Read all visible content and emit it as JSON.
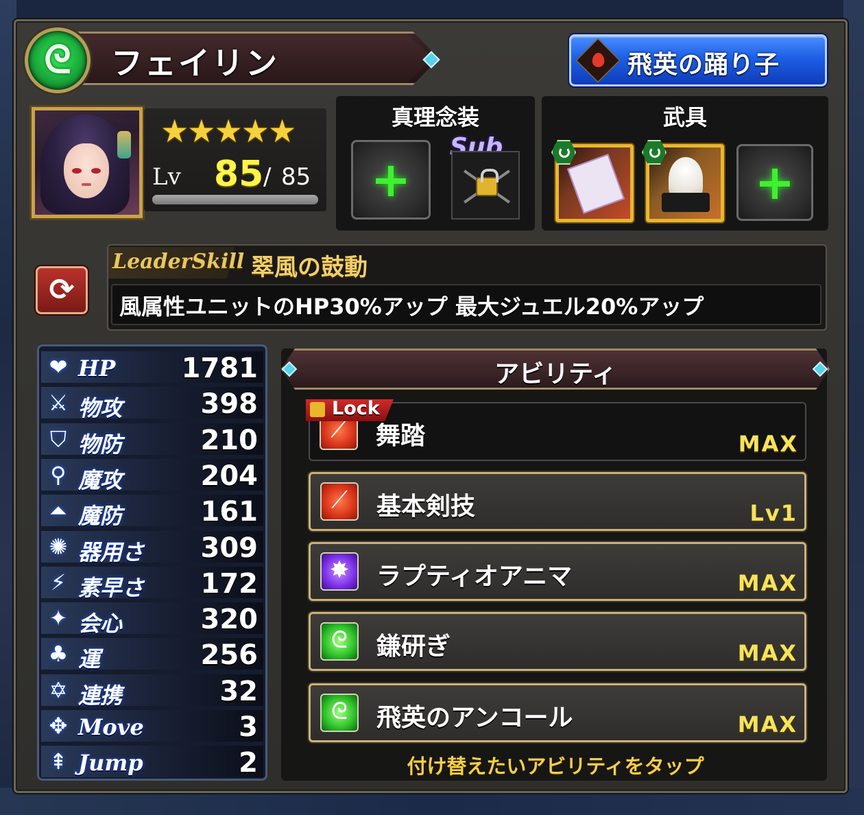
{
  "character": {
    "name": "フェイリン",
    "element_icon": "wind-element-icon",
    "title": "飛英の踊り子",
    "stars": "★★★★★",
    "level_label": "Lv",
    "level": "85",
    "level_separator": "/",
    "level_max": "85",
    "level_progress": 1.0
  },
  "truth_panel": {
    "title": "真理念装",
    "sub_label": "Sub"
  },
  "gear_panel": {
    "title": "武具"
  },
  "leader_skill": {
    "tag": "LeaderSkill",
    "name": "翠風の鼓動",
    "description": "風属性ユニットのHP30%アップ  最大ジュエル20%アップ"
  },
  "stats": [
    {
      "label": "HP",
      "value": "1781",
      "icon": "heart-icon",
      "glyph": "❤"
    },
    {
      "label": "物攻",
      "value": "398",
      "icon": "sword-icon",
      "glyph": "⚔"
    },
    {
      "label": "物防",
      "value": "210",
      "icon": "shield-icon",
      "glyph": "⛉"
    },
    {
      "label": "魔攻",
      "value": "204",
      "icon": "staff-icon",
      "glyph": "⚲"
    },
    {
      "label": "魔防",
      "value": "161",
      "icon": "magic-shield-icon",
      "glyph": "⏶"
    },
    {
      "label": "器用さ",
      "value": "309",
      "icon": "dexterity-icon",
      "glyph": "✺"
    },
    {
      "label": "素早さ",
      "value": "172",
      "icon": "boot-icon",
      "glyph": "⚡"
    },
    {
      "label": "会心",
      "value": "320",
      "icon": "critical-icon",
      "glyph": "✦"
    },
    {
      "label": "運",
      "value": "256",
      "icon": "clover-icon",
      "glyph": "♣"
    },
    {
      "label": "連携",
      "value": "32",
      "icon": "link-icon",
      "glyph": "✡"
    },
    {
      "label": "Move",
      "value": "3",
      "icon": "move-arrows-icon",
      "glyph": "✥"
    },
    {
      "label": "Jump",
      "value": "2",
      "icon": "jump-icon",
      "glyph": "⇞"
    }
  ],
  "abilities": {
    "header": "アビリティ",
    "lock_label": "Lock",
    "hint": "付け替えたいアビリティをタップ",
    "items": [
      {
        "name": "舞踏",
        "level": "MAX",
        "icon": "red-slash-icon",
        "locked": true
      },
      {
        "name": "基本剣技",
        "level": "Lv1",
        "icon": "red-slash-icon",
        "locked": false
      },
      {
        "name": "ラプティオアニマ",
        "level": "MAX",
        "icon": "purple-burst-icon",
        "locked": false
      },
      {
        "name": "鎌研ぎ",
        "level": "MAX",
        "icon": "green-wind-icon",
        "locked": false
      },
      {
        "name": "飛英のアンコール",
        "level": "MAX",
        "icon": "green-wind-icon",
        "locked": false
      }
    ]
  }
}
